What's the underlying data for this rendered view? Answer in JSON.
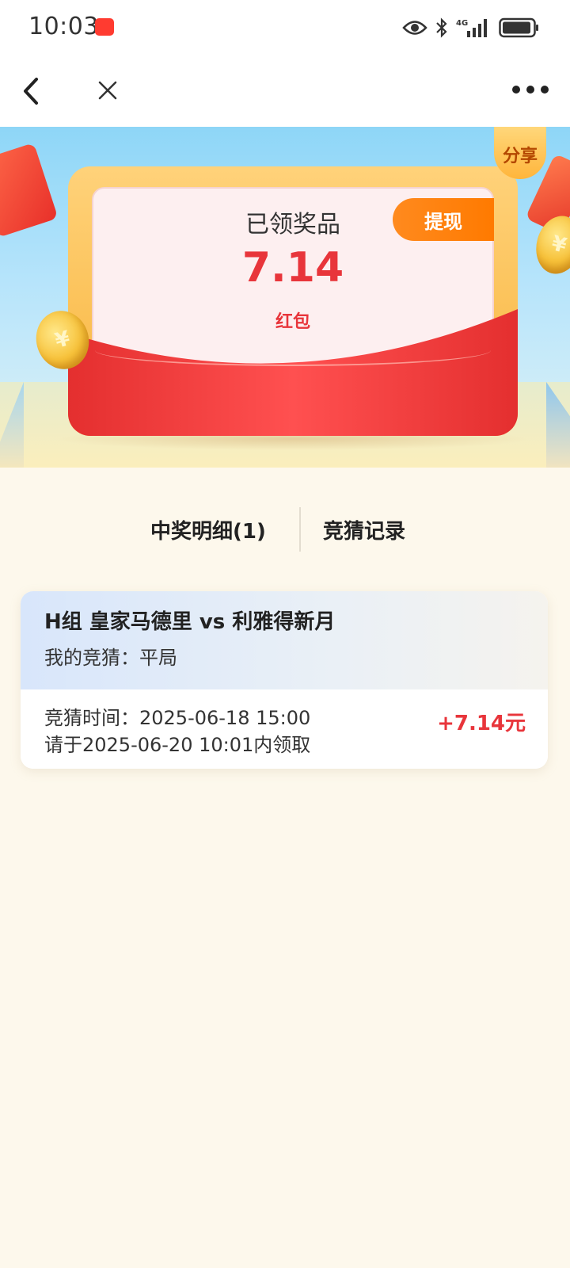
{
  "status_bar": {
    "time": "10:03",
    "icons": [
      "app-badge-icon",
      "eye-icon",
      "bluetooth-icon",
      "signal-4g-icon",
      "battery-icon"
    ],
    "network": "4G"
  },
  "nav": {
    "icons": [
      "back-arrow-icon",
      "close-icon",
      "more-icon"
    ]
  },
  "hero": {
    "share_label": "分享",
    "prize_title": "已领奖品",
    "prize_amount": "7.14",
    "prize_unit": "红包",
    "withdraw_label": "提现",
    "coin_symbol": "¥"
  },
  "tabs": [
    {
      "label": "中奖明细(1)",
      "active": true
    },
    {
      "label": "竞猜记录",
      "active": false
    }
  ],
  "records": [
    {
      "match": "H组 皇家马德里 vs 利雅得新月",
      "my_guess": "我的竞猜：平局",
      "guess_time": "竞猜时间：2025-06-18 15:00",
      "claim_deadline": "请于2025-06-20 10:01内领取",
      "reward": "+7.14元"
    }
  ],
  "colors": {
    "accent_red": "#e8353b",
    "withdraw_orange": "#ff7a00",
    "page_bg": "#fdf8ec"
  }
}
